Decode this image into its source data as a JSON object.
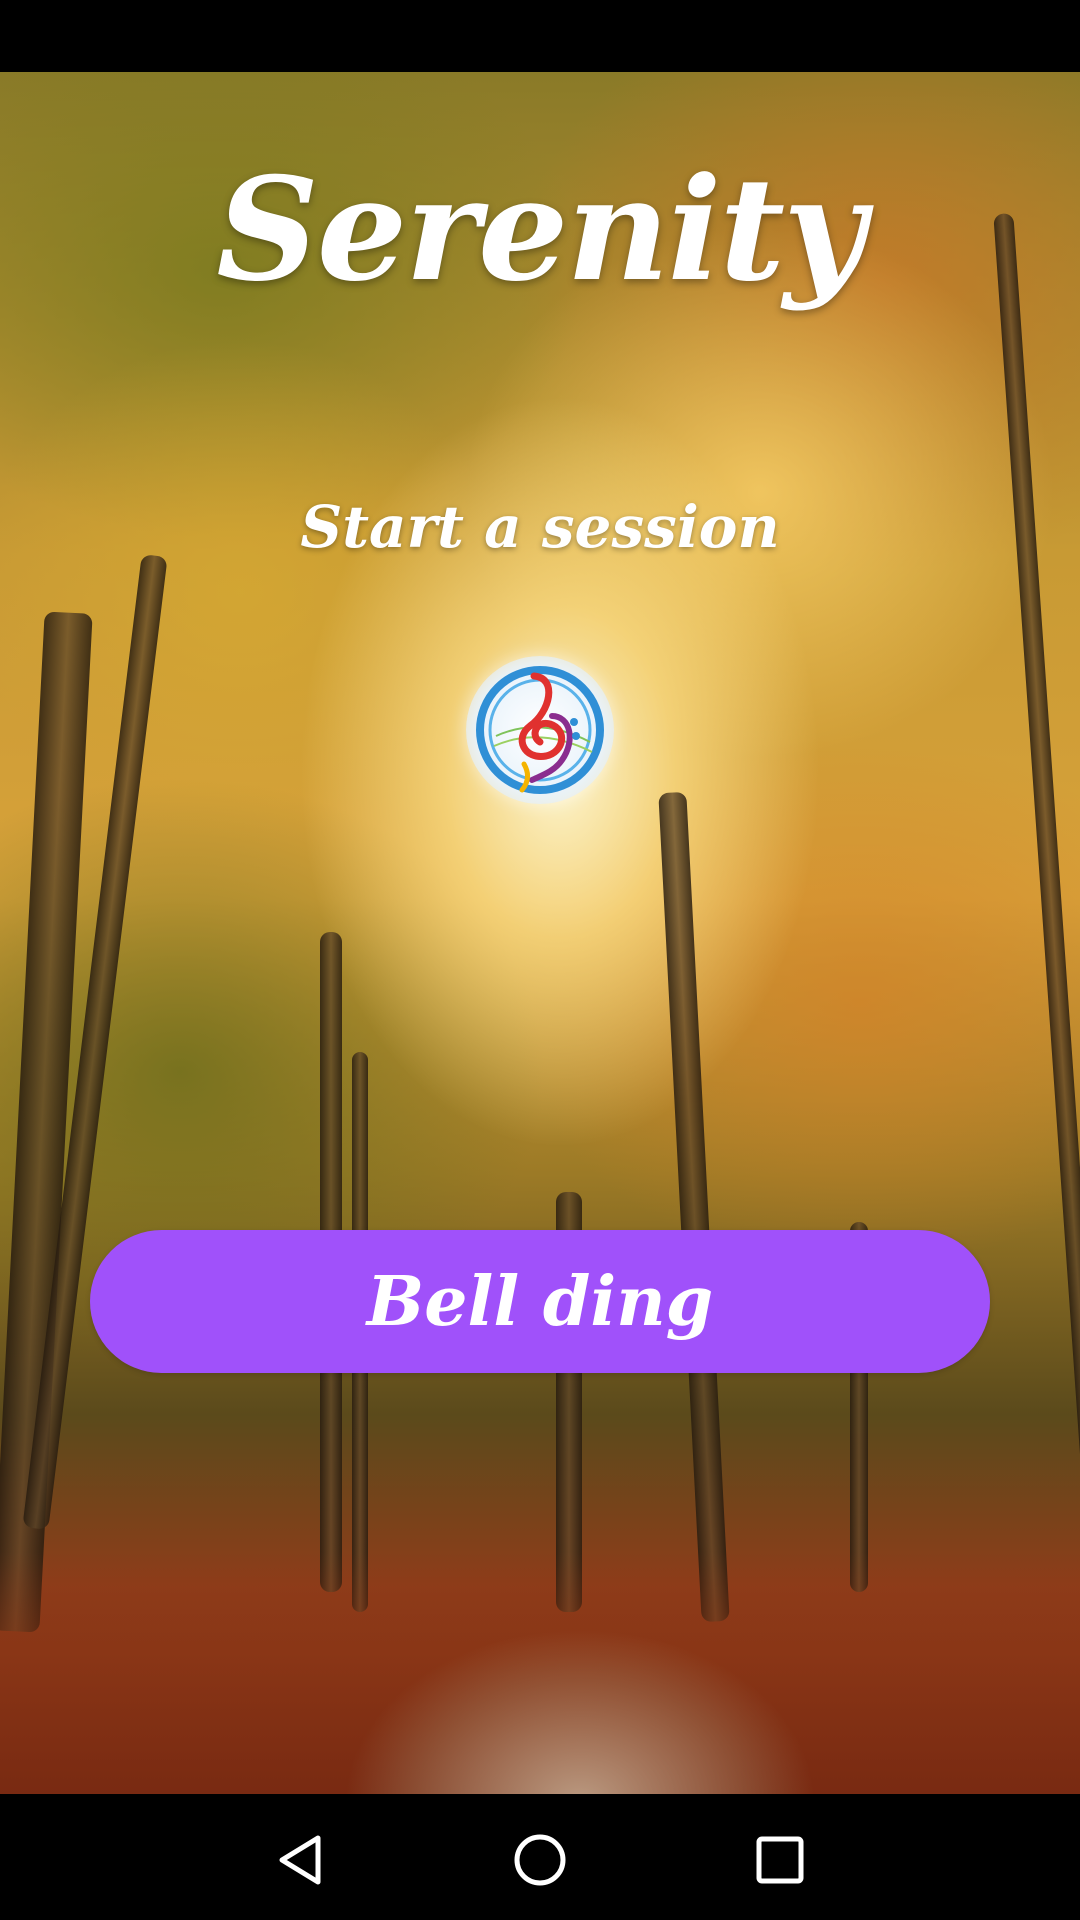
{
  "app": {
    "title": "Serenity",
    "subtitle": "Start a session",
    "logo_icon": "music-swirl-logo-icon"
  },
  "actions": {
    "bell_button_label": "Bell ding"
  },
  "colors": {
    "button_bg": "#a051fa",
    "text": "#ffffff",
    "nav_bar": "#000000"
  },
  "nav": {
    "back_icon": "back-triangle-icon",
    "home_icon": "home-circle-icon",
    "recents_icon": "recents-square-icon"
  }
}
